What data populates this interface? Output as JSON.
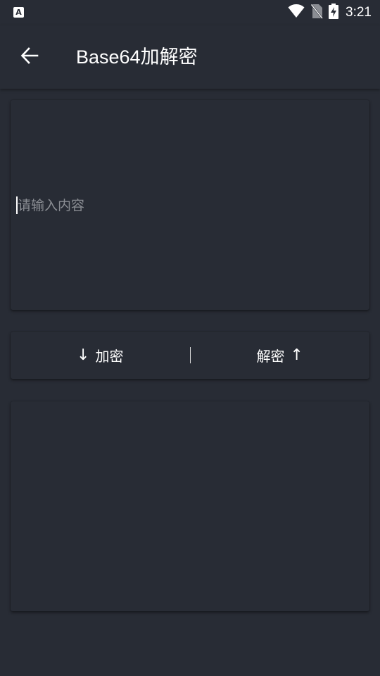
{
  "status_bar": {
    "left_icon": "A",
    "time": "3:21",
    "icons": [
      "wifi-icon",
      "no-sim-icon",
      "battery-charging-icon"
    ]
  },
  "app_bar": {
    "title": "Base64加解密",
    "back_icon": "arrow-left-icon"
  },
  "input": {
    "value": "",
    "placeholder": "请输入内容"
  },
  "actions": {
    "encrypt_label": "加密",
    "encrypt_arrow": "↓",
    "decrypt_label": "解密",
    "decrypt_arrow": "↑"
  },
  "output": {
    "value": ""
  },
  "colors": {
    "background": "#282c35",
    "text": "#ffffff",
    "placeholder": "#8a8d93"
  }
}
